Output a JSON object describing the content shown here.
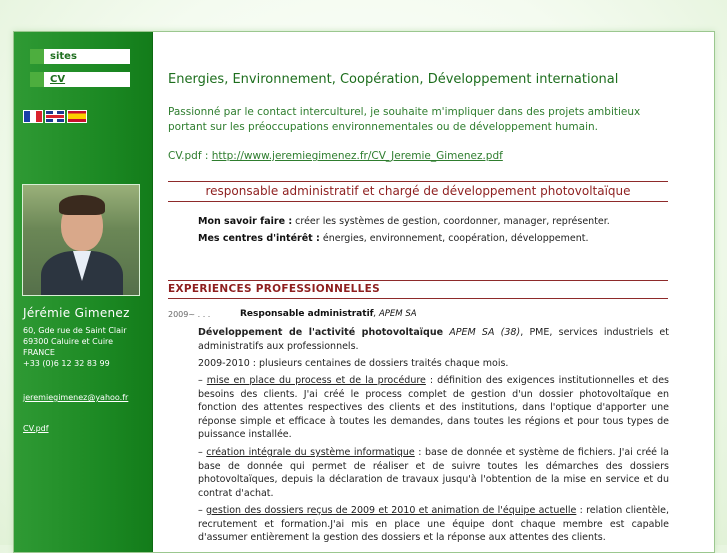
{
  "sidebar": {
    "nav": [
      "sites",
      "CV"
    ],
    "flags": [
      "flag-fr",
      "flag-uk",
      "flag-es"
    ],
    "name": "Jérémie Gimenez",
    "address": [
      "60, Gde rue de Saint Clair",
      "69300 Caluire et Cuire",
      "FRANCE",
      "+33 (0)6 12 32 83 99"
    ],
    "email": "jeremiegimenez@yahoo.fr",
    "cv_link": "CV.pdf"
  },
  "main": {
    "title": "Energies, Environnement, Coopération, Développement international",
    "intro": "Passionné par le contact interculturel, je souhaite m'impliquer dans des projets ambitieux portant sur les préoccupations environnementales ou de développement humain.",
    "cv_label": "CV.pdf :",
    "cv_url": "http://www.jeremiegimenez.fr/CV_Jeremie_Gimenez.pdf",
    "post_title": "responsable administratif et chargé de développement photovoltaïque",
    "savoir_label": "Mon savoir faire :",
    "savoir_text": "créer les systèmes de gestion, coordonner, manager, représenter.",
    "interets_label": "Mes centres d'intérêt :",
    "interets_text": "énergies, environnement, coopération, développement.",
    "section_title": "EXPERIENCES PROFESSIONNELLES",
    "job_period": "2009~  . . .",
    "job_role": "Responsable administratif",
    "job_company": ", APEM SA",
    "dev_title": "Développement de l'activité photovoltaïque",
    "dev_company": "APEM SA (38)",
    "dev_text": ", PME, services industriels et administratifs aux professionnels.",
    "dossiers": "2009-2010 : plusieurs centaines de dossiers traités chaque mois.",
    "item1_title": "mise en place du process et de la procédure",
    "item1_text": " : définition des exigences institutionnelles et des besoins des clients. J'ai créé le process complet de gestion d'un dossier photovoltaïque en fonction des attentes respectives des clients et des institutions, dans l'optique d'apporter une réponse simple et efficace à toutes les demandes, dans toutes les régions et pour tous types de puissance installée.",
    "item2_title": "création intégrale du système informatique",
    "item2_text": " : base de donnée et système de fichiers. J'ai créé la base de donnée qui permet de réaliser et de suivre toutes les démarches des dossiers photovoltaïques, depuis la déclaration de travaux jusqu'à l'obtention de la mise en service et du contrat d'achat.",
    "item3_title": "gestion des dossiers reçus de 2009 et 2010 et animation de l'équipe actuelle",
    "item3_text": " : relation clientèle, recrutement et formation.J'ai mis en place une équipe dont chaque membre est capable d'assumer entièrement la gestion des dossiers et la réponse aux attentes des clients.",
    "dash": "– "
  },
  "colors": {
    "green": "#1d8a24",
    "title_green": "#1d6e1d",
    "red": "#8e1f1f"
  }
}
